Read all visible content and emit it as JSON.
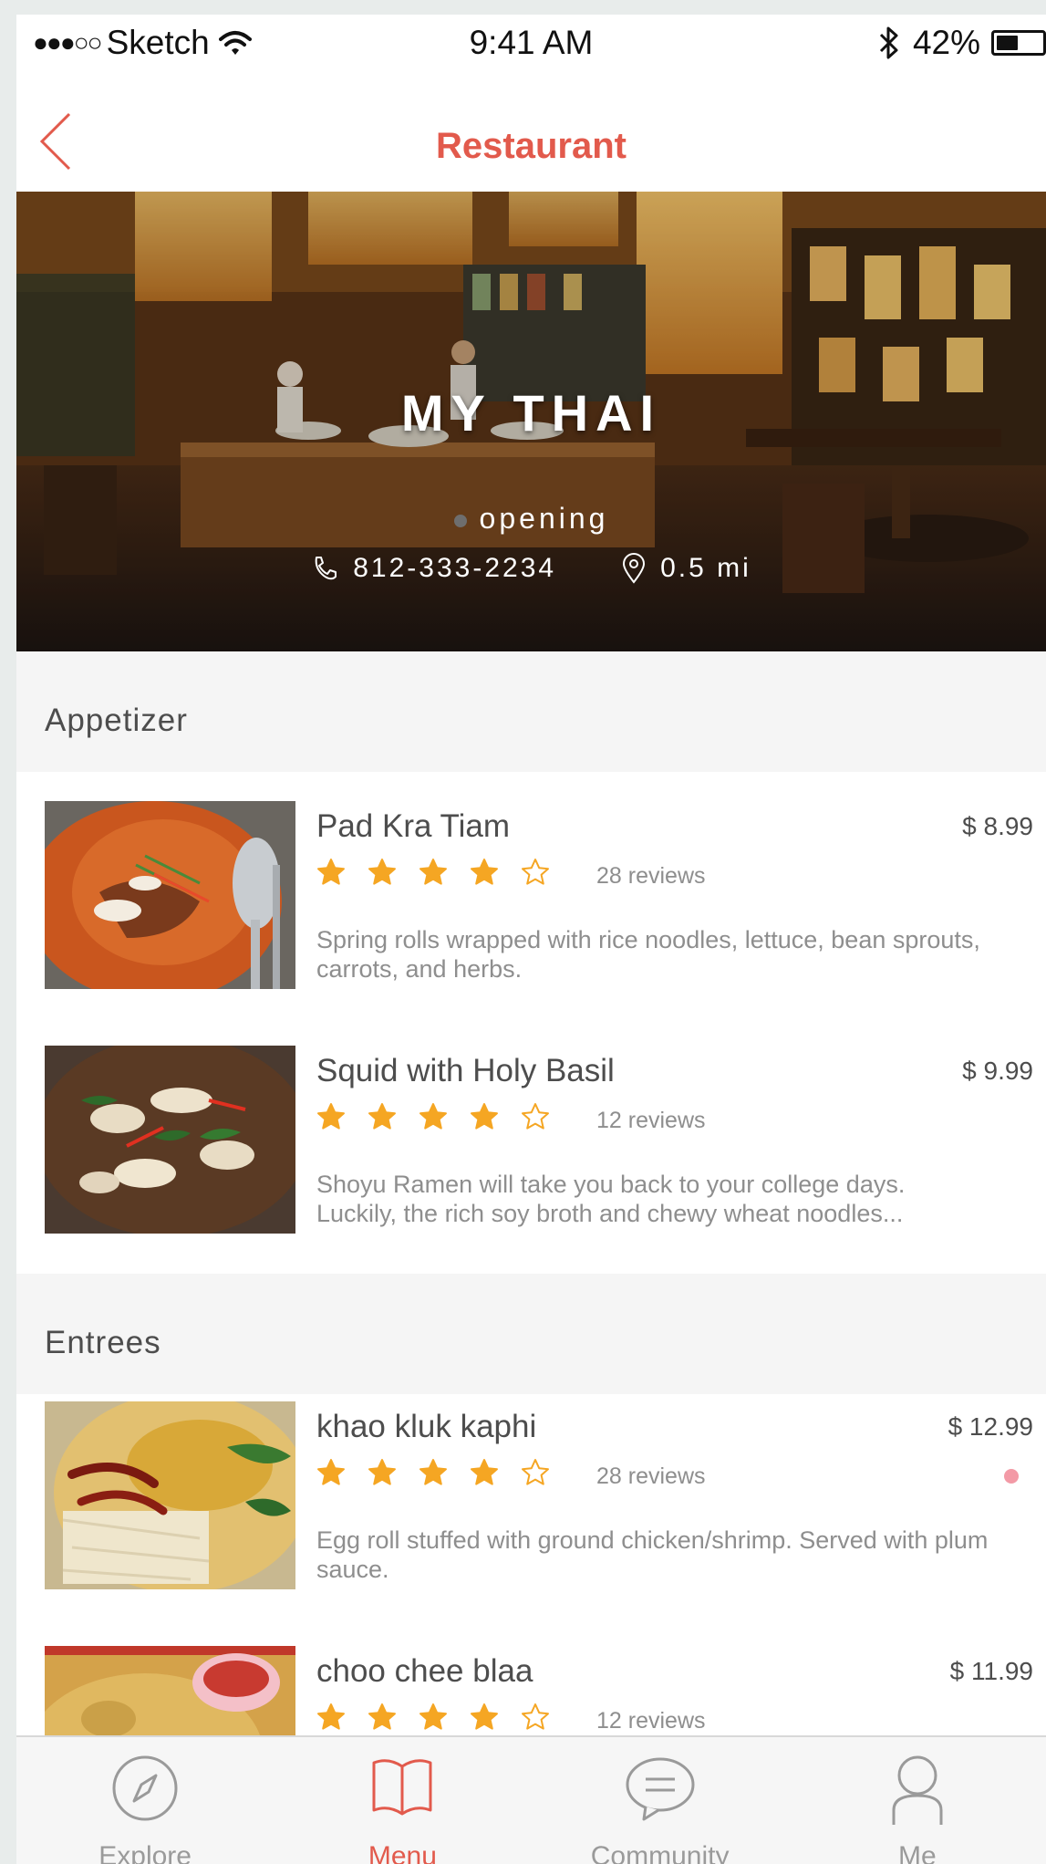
{
  "status_bar": {
    "signal": "●●●○○",
    "carrier": "Sketch",
    "time": "9:41 AM",
    "battery": "42%",
    "battery_level": 0.42
  },
  "nav": {
    "title": "Restaurant"
  },
  "hero": {
    "name": "MY THAI",
    "status": "opening",
    "phone": "812-333-2234",
    "distance": "0.5 mi"
  },
  "sections": [
    {
      "title": "Appetizer",
      "items": [
        {
          "name": "Pad Kra Tiam",
          "price": "$ 8.99",
          "rating": 4,
          "reviews": "28 reviews",
          "description": "Spring rolls wrapped with rice noodles, lettuce, bean sprouts, carrots, and herbs."
        },
        {
          "name": "Squid with Holy Basil",
          "price": "$  9.99",
          "rating": 4,
          "reviews": "12 reviews",
          "description": "Shoyu Ramen will take you back to your college days. Luckily, the rich soy broth and chewy wheat noodles..."
        }
      ]
    },
    {
      "title": "Entrees",
      "items": [
        {
          "name": "khao kluk kaphi",
          "price": "$ 12.99",
          "rating": 4,
          "reviews": "28 reviews",
          "description": "Egg roll stuffed with ground chicken/shrimp. Served with plum sauce."
        },
        {
          "name": "choo chee blaa",
          "price": "$  11.99",
          "rating": 4,
          "reviews": "12 reviews",
          "description": ""
        }
      ]
    }
  ],
  "tabs": [
    {
      "label": "Explore",
      "icon": "compass-icon",
      "active": false
    },
    {
      "label": "Menu",
      "icon": "book-icon",
      "active": true
    },
    {
      "label": "Community",
      "icon": "chat-bubble-icon",
      "active": false
    },
    {
      "label": "Me",
      "icon": "person-icon",
      "active": false
    }
  ],
  "colors": {
    "accent": "#e25a4c",
    "star": "#f5a623",
    "text": "#4d4d4d",
    "muted": "#8e8e8e",
    "section_bg": "#f5f5f5"
  }
}
